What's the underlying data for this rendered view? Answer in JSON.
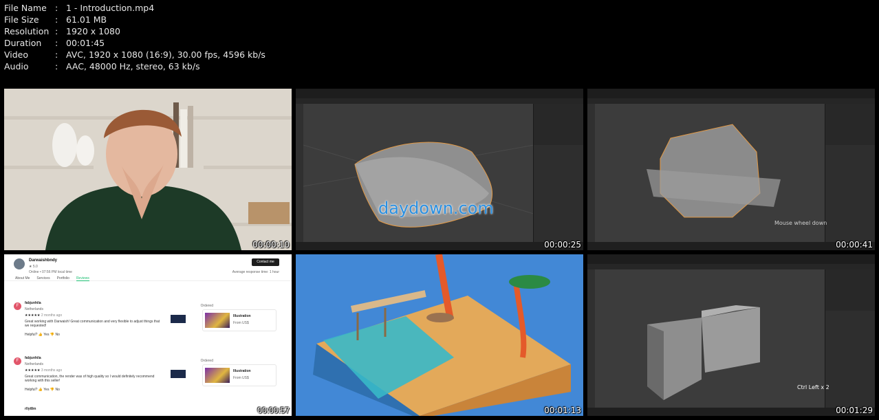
{
  "file_info": [
    {
      "key": "File Name",
      "value": "1 - Introduction.mp4"
    },
    {
      "key": "File Size",
      "value": "61.01 MB"
    },
    {
      "key": "Resolution",
      "value": "1920 x 1080"
    },
    {
      "key": "Duration",
      "value": "00:01:45"
    },
    {
      "key": "Video",
      "value": "AVC, 1920 x 1080 (16:9), 30.00 fps, 4596 kb/s"
    },
    {
      "key": "Audio",
      "value": "AAC, 48000 Hz, stereo, 63 kb/s"
    }
  ],
  "thumbnails": [
    {
      "timestamp": "00:00:10"
    },
    {
      "timestamp": "00:00:25",
      "watermark": "daydown.com"
    },
    {
      "timestamp": "00:00:41",
      "overlay": "Mouse wheel down"
    },
    {
      "timestamp": "00:00:57"
    },
    {
      "timestamp": "00:01:13"
    },
    {
      "timestamp": "00:01:29",
      "overlay": "Ctrl Left x 2"
    }
  ],
  "review_page": {
    "seller_name": "Darwaishbndy",
    "rating": "5.0",
    "local_time": "Online • 07:56 PM local time",
    "response_time": "Average response time: 1 hour",
    "contact_button": "Contact me",
    "tabs": [
      "About Me",
      "Services",
      "Portfolio",
      "Reviews"
    ],
    "reviews": [
      {
        "initial": "F",
        "user": "fabjunhila",
        "country": "Netherlands",
        "when": "2 months ago",
        "text": "Great working with Darwaish! Great communication and very flexible to adjust things that we requested!",
        "helpful": "Helpful?",
        "yes": "Yes",
        "no": "No",
        "ordered_label": "Ordered",
        "item_title": "Illustration",
        "item_price": "From US$"
      },
      {
        "initial": "F",
        "user": "fabjunhila",
        "country": "Netherlands",
        "when": "3 months ago",
        "text": "Great communication, the render was of high quality so I would definitely recommend working with this seller!",
        "helpful": "Helpful?",
        "yes": "Yes",
        "no": "No",
        "ordered_label": "Ordered",
        "item_title": "Illustration",
        "item_price": "From US$"
      }
    ],
    "next_user": "rllyt8m"
  }
}
